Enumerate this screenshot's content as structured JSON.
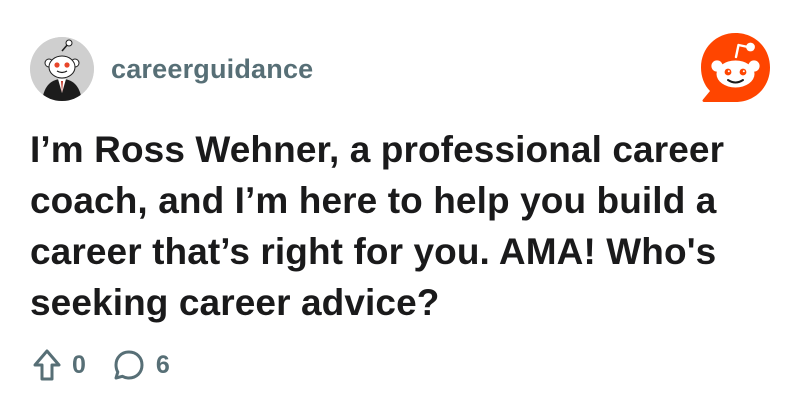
{
  "post": {
    "community": "careerguidance",
    "title": "I’m Ross Wehner, a professional career coach, and I’m here to help you build a career that’s right for you. AMA! Who's seeking career advice?",
    "upvotes": "0",
    "comments": "6"
  },
  "icons": {
    "avatar": "reddit-snoo-avatar-icon",
    "logo": "reddit-logo-icon",
    "upvote": "upvote-arrow-icon",
    "comment": "comment-bubble-icon"
  },
  "colors": {
    "brand": "#ff4500",
    "muted_text": "#576f76",
    "title_text": "#1a1a1b"
  }
}
